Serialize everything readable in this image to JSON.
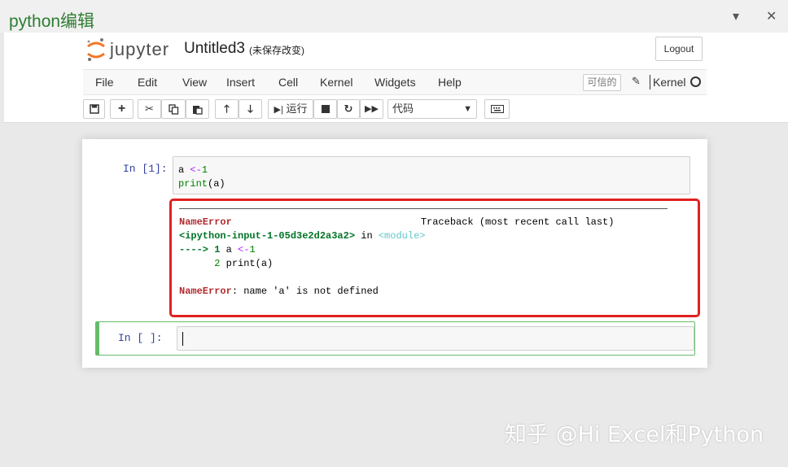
{
  "frame": {
    "title": "python编辑",
    "dropdown_glyph": "▾",
    "close_glyph": "✕"
  },
  "header": {
    "logo_text": "jupyter",
    "notebook_name": "Untitled3",
    "save_status": "(未保存改变)",
    "logout_label": "Logout"
  },
  "menu": {
    "items": [
      "File",
      "Edit",
      "View",
      "Insert",
      "Cell",
      "Kernel",
      "Widgets",
      "Help"
    ],
    "trusted_label": "可信的",
    "kernel_label": "Kernel"
  },
  "toolbar": {
    "run_label": "运行",
    "cell_type": "代码",
    "icons": [
      "save-icon",
      "plus-icon",
      "cut-icon",
      "copy-icon",
      "paste-icon",
      "arrow-up-icon",
      "arrow-down-icon",
      "run-icon",
      "stop-icon",
      "restart-icon",
      "fast-forward-icon",
      "keyboard-icon"
    ]
  },
  "cells": [
    {
      "prompt": "In  [1]:",
      "code_line1": {
        "var": "a",
        "op": "<-",
        "num": "1"
      },
      "code_line2": {
        "fn": "print",
        "arg": "(a)"
      },
      "output": {
        "error_name": "NameError",
        "traceback_label": "Traceback (most recent call last)",
        "input_ref": "<ipython-input-1-05d3e2d2a3a2>",
        "in_word": "in",
        "module_ref": "<module>",
        "arrow": "----> 1",
        "line1_code_var": "a",
        "line1_code_op": "<-",
        "line1_code_num": "1",
        "line2_no": "2",
        "line2_code": "print(a)",
        "final_error": "NameError",
        "final_message": ": name 'a' is not defined"
      }
    },
    {
      "prompt": "In  [ ]:"
    }
  ],
  "watermark": "知乎 @Hi Excel和Python"
}
